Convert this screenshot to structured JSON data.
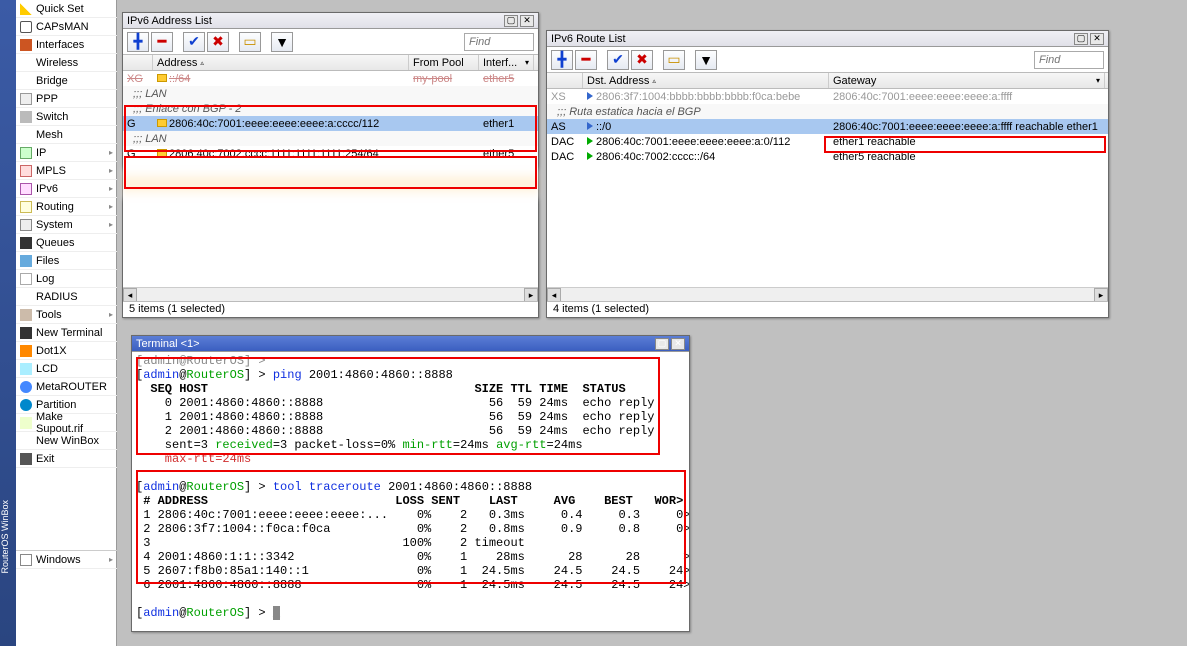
{
  "sidebar": {
    "strip_text": "RouterOS WinBox",
    "items": [
      {
        "label": "Quick Set",
        "icon": "ic-wand",
        "sub": false
      },
      {
        "label": "CAPsMAN",
        "icon": "ic-caps",
        "sub": false
      },
      {
        "label": "Interfaces",
        "icon": "ic-if",
        "sub": false
      },
      {
        "label": "Wireless",
        "icon": "ic-wifi",
        "sub": false
      },
      {
        "label": "Bridge",
        "icon": "ic-bridge",
        "sub": false
      },
      {
        "label": "PPP",
        "icon": "ic-ppp",
        "sub": false
      },
      {
        "label": "Switch",
        "icon": "ic-switch",
        "sub": false
      },
      {
        "label": "Mesh",
        "icon": "ic-mesh",
        "sub": false
      },
      {
        "label": "IP",
        "icon": "ic-ip",
        "sub": true
      },
      {
        "label": "MPLS",
        "icon": "ic-mpls",
        "sub": true
      },
      {
        "label": "IPv6",
        "icon": "ic-ipv6",
        "sub": true
      },
      {
        "label": "Routing",
        "icon": "ic-route",
        "sub": true
      },
      {
        "label": "System",
        "icon": "ic-sys",
        "sub": true
      },
      {
        "label": "Queues",
        "icon": "ic-queue",
        "sub": false
      },
      {
        "label": "Files",
        "icon": "ic-files",
        "sub": false
      },
      {
        "label": "Log",
        "icon": "ic-log",
        "sub": false
      },
      {
        "label": "RADIUS",
        "icon": "ic-radius",
        "sub": false
      },
      {
        "label": "Tools",
        "icon": "ic-tools",
        "sub": true
      },
      {
        "label": "New Terminal",
        "icon": "ic-term",
        "sub": false
      },
      {
        "label": "Dot1X",
        "icon": "ic-dot1x",
        "sub": false
      },
      {
        "label": "LCD",
        "icon": "ic-lcd",
        "sub": false
      },
      {
        "label": "MetaROUTER",
        "icon": "ic-meta",
        "sub": false
      },
      {
        "label": "Partition",
        "icon": "ic-part",
        "sub": false
      },
      {
        "label": "Make Supout.rif",
        "icon": "ic-supout",
        "sub": false
      },
      {
        "label": "New WinBox",
        "icon": "ic-winbox",
        "sub": false
      },
      {
        "label": "Exit",
        "icon": "ic-exit",
        "sub": false
      }
    ],
    "bottom": {
      "label": "Windows",
      "icon": "ic-windows",
      "sub": true
    }
  },
  "addrlist": {
    "title": "IPv6 Address List",
    "find_placeholder": "Find",
    "columns": {
      "c1": "",
      "c2": "Address",
      "c3": "From Pool",
      "c4": "Interf..."
    },
    "rows": [
      {
        "flag": "XG",
        "addr": "::/64",
        "pool": "my-pool",
        "intf": "ether5",
        "struck": true
      },
      {
        "comment": ";;; LAN"
      },
      {
        "comment": ";;; Enlace con BGP - 2",
        "sel": true
      },
      {
        "flag": "G",
        "addr": "2806:40c:7001:eeee:eeee:eeee:a:cccc/112",
        "pool": "",
        "intf": "ether1",
        "sel": true
      },
      {
        "comment": ";;; LAN"
      },
      {
        "flag": "G",
        "addr": "2806:40c:7002:cccc:1111:1111:1111:254/64",
        "pool": "",
        "intf": "ether5"
      }
    ],
    "status": "5 items (1 selected)"
  },
  "routelist": {
    "title": "IPv6 Route List",
    "find_placeholder": "Find",
    "columns": {
      "c1": "",
      "c2": "Dst. Address",
      "c3": "Gateway"
    },
    "rows": [
      {
        "flag": "XS",
        "dst": "2806:3f7:1004:bbbb:bbbb:bbbb:f0ca:bebe",
        "gw": "2806:40c:7001:eeee:eeee:eeee:a:ffff",
        "ic": "blue"
      },
      {
        "comment": ";;; Ruta estatica hacia el BGP"
      },
      {
        "flag": "AS",
        "dst": "::/0",
        "gw": "2806:40c:7001:eeee:eeee:eeee:a:ffff reachable ether1",
        "sel": true,
        "ic": "blue"
      },
      {
        "flag": "DAC",
        "dst": "2806:40c:7001:eeee:eeee:eeee:a:0/112",
        "gw": "ether1 reachable",
        "ic": "green"
      },
      {
        "flag": "DAC",
        "dst": "2806:40c:7002:cccc::/64",
        "gw": "ether5 reachable",
        "ic": "green"
      }
    ],
    "status": "4 items (1 selected)"
  },
  "terminal": {
    "title": "Terminal <1>",
    "prompt_user": "admin",
    "prompt_host": "RouterOS",
    "ping_cmd": "ping 2001:4860:4860::8888",
    "ping_header": "  SEQ HOST                                     SIZE TTL TIME  STATUS",
    "ping_rows": [
      "    0 2001:4860:4860::8888                       56  59 24ms  echo reply",
      "    1 2001:4860:4860::8888                       56  59 24ms  echo reply",
      "    2 2001:4860:4860::8888                       56  59 24ms  echo reply"
    ],
    "ping_sum_pre": "    sent=3 ",
    "ping_sum_recv": "received",
    "ping_sum_mid": "=3 packet-loss=0% ",
    "ping_sum_min": "min-rtt",
    "ping_sum_mid2": "=24ms ",
    "ping_sum_avg": "avg-rtt",
    "ping_sum_end": "=24ms",
    "ping_sum_line2": "    max-rtt=24ms",
    "trace_cmd": "tool traceroute 2001:4860:4860::8888",
    "trace_header": " # ADDRESS                          LOSS SENT    LAST     AVG    BEST   WOR>",
    "trace_rows": [
      " 1 2806:40c:7001:eeee:eeee:eeee:...    0%    2   0.3ms     0.4     0.3     0>",
      " 2 2806:3f7:1004::f0ca:f0ca            0%    2   0.8ms     0.9     0.8     0>",
      " 3                                   100%    2 timeout",
      " 4 2001:4860:1:1::3342                 0%    1    28ms      28      28      >",
      " 5 2607:f8b0:85a1:140::1               0%    1  24.5ms    24.5    24.5    24>",
      " 6 2001:4860:4860::8888                0%    1  24.5ms    24.5    24.5    24>"
    ],
    "last_prompt": "[admin@RouterOS] > "
  }
}
